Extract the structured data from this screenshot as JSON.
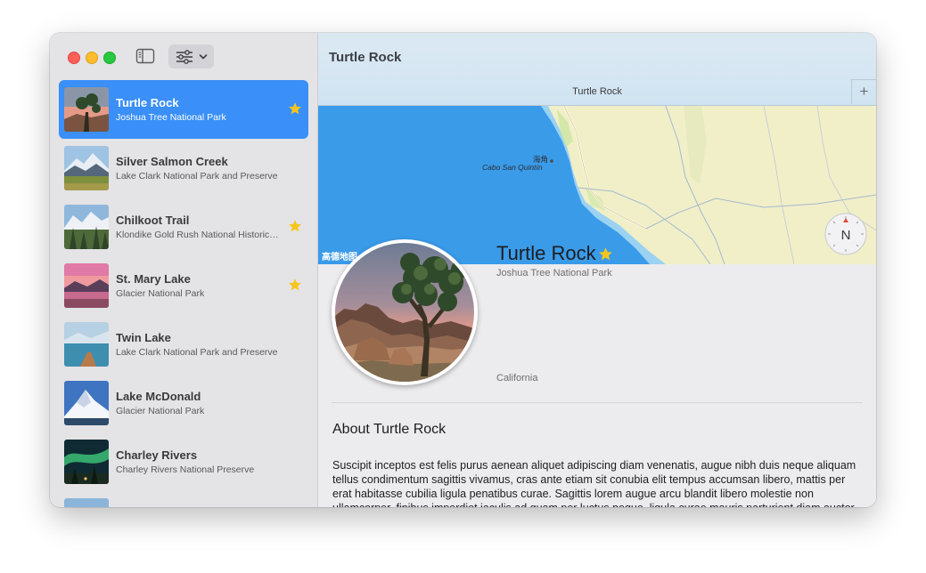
{
  "window": {
    "title": "Turtle Rock"
  },
  "tab": {
    "label": "Turtle Rock",
    "add_label": "+"
  },
  "landmarks": [
    {
      "name": "Turtle Rock",
      "park": "Joshua Tree National Park",
      "favorite": true,
      "selected": true,
      "thumb": "joshua-tree"
    },
    {
      "name": "Silver Salmon Creek",
      "park": "Lake Clark National Park and Preserve",
      "favorite": false,
      "selected": false,
      "thumb": "mountain-meadow"
    },
    {
      "name": "Chilkoot Trail",
      "park": "Klondike Gold Rush National Historic…",
      "favorite": true,
      "selected": false,
      "thumb": "snowy-forest"
    },
    {
      "name": "St. Mary Lake",
      "park": "Glacier National Park",
      "favorite": true,
      "selected": false,
      "thumb": "pink-sunset-lake"
    },
    {
      "name": "Twin Lake",
      "park": "Lake Clark National Park and Preserve",
      "favorite": false,
      "selected": false,
      "thumb": "lake-boat"
    },
    {
      "name": "Lake McDonald",
      "park": "Glacier National Park",
      "favorite": false,
      "selected": false,
      "thumb": "snowy-peak"
    },
    {
      "name": "Charley Rivers",
      "park": "Charley Rivers National Preserve",
      "favorite": false,
      "selected": false,
      "thumb": "aurora"
    },
    {
      "name": "",
      "park": "",
      "favorite": false,
      "selected": false,
      "thumb": "sky"
    }
  ],
  "map": {
    "label_small": "海角",
    "label_city": "Cabo San Quintín",
    "legal": "高德地图",
    "compass_letter": "N"
  },
  "detail": {
    "name": "Turtle Rock",
    "park": "Joshua Tree National Park",
    "state": "California",
    "favorite": true,
    "about_title": "About Turtle Rock",
    "about_body": "Suscipit inceptos est felis purus aenean aliquet adipiscing diam venenatis, augue nibh duis neque aliquam tellus condimentum sagittis vivamus, cras ante etiam sit conubia elit tempus accumsan libero, mattis per erat habitasse cubilia ligula penatibus curae. Sagittis lorem augue arcu blandit libero molestie non ullamcorper, finibus imperdiet iaculis ad quam per luctus neque, ligula curae mauris parturient diam auctor eleifend laoreet ridiculus, hendrerit adipiscing sociosqu pretium nec velit aliquam."
  },
  "colors": {
    "accent": "#3a8ff8",
    "star": "#f8c51c",
    "ocean": "#3a9be9",
    "land": "#f1efc8"
  }
}
